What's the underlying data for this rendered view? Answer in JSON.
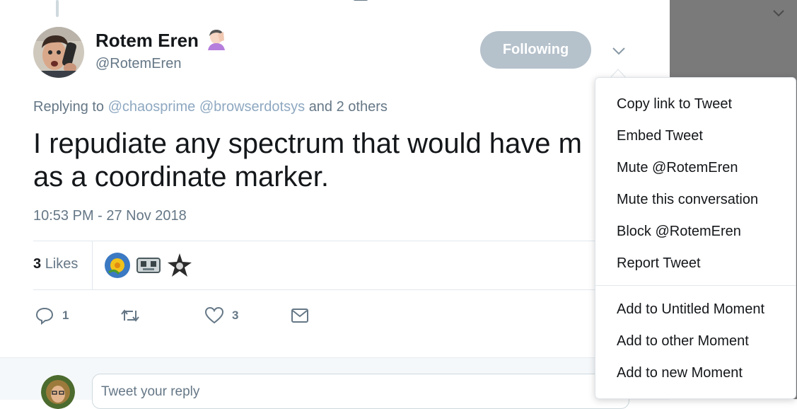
{
  "tweet": {
    "author_name": "Rotem Eren",
    "author_handle": "@RotemEren",
    "follow_button": "Following",
    "reply_prefix": "Replying to",
    "reply_mention_1": "@chaosprime",
    "reply_mention_2": "@browserdotsys",
    "reply_suffix": "and 2 others",
    "text": "I repudiate any spectrum that would have m\nas a coordinate marker.",
    "timestamp": "10:53 PM - 27 Nov 2018",
    "likes_count": "3",
    "likes_label": "Likes"
  },
  "actions": {
    "reply_count": "1",
    "retweet_count": "",
    "like_count": "3"
  },
  "reply_box": {
    "placeholder": "Tweet your reply"
  },
  "menu": {
    "items": [
      "Copy link to Tweet",
      "Embed Tweet",
      "Mute @RotemEren",
      "Mute this conversation",
      "Block @RotemEren",
      "Report Tweet",
      "Add to Untitled Moment",
      "Add to other Moment",
      "Add to new Moment"
    ]
  },
  "colors": {
    "accent_muted": "#b5c1cb",
    "text_secondary": "#657786",
    "link": "#8ea8c1",
    "overlay": "#7a7a7a"
  },
  "icons": [
    "reply-icon",
    "retweet-icon",
    "heart-icon",
    "envelope-icon",
    "chevron-down-icon",
    "facepalm-emoji-icon"
  ]
}
